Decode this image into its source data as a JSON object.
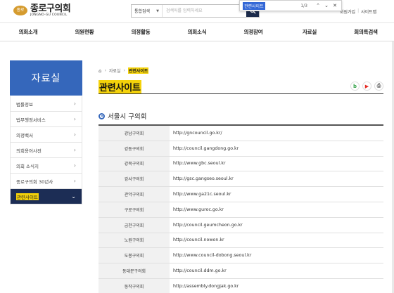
{
  "header": {
    "logo_ko": "종로구의회",
    "logo_en": "JONGNO-GU COUNCIL",
    "logo_mark": "종로",
    "search": {
      "scope": "통합검색",
      "placeholder": "검색어를 입력하세요"
    },
    "util_links": [
      "회원가입",
      "사이트맵"
    ]
  },
  "findbar": {
    "query": "관련사이트",
    "count": "1/3"
  },
  "nav": {
    "items": [
      "의회소개",
      "의원현황",
      "의정활동",
      "의회소식",
      "의정참여",
      "자료실",
      "회의록검색"
    ]
  },
  "sidebar": {
    "title": "자료실",
    "items": [
      {
        "label": "법률정보",
        "active": false
      },
      {
        "label": "법무행정서비스",
        "active": false
      },
      {
        "label": "의정백서",
        "active": false
      },
      {
        "label": "의회용어사전",
        "active": false
      },
      {
        "label": "의회 소식지",
        "active": false
      },
      {
        "label": "종로구의회 30년사",
        "active": false
      },
      {
        "label": "관련사이트",
        "active": true
      }
    ]
  },
  "breadcrumb": {
    "items": [
      "자료실",
      "관련사이트"
    ]
  },
  "page_title": "관련사이트",
  "share": {
    "blog": "b",
    "youtube": "▶",
    "print": "⎙"
  },
  "section_title": "서울시 구의회",
  "table": {
    "rows": [
      {
        "name": "강남구의회",
        "url": "http://gncouncil.go.kr/"
      },
      {
        "name": "강동구의회",
        "url": "http://council.gangdong.go.kr"
      },
      {
        "name": "강북구의회",
        "url": "http://www.gbc.seoul.kr"
      },
      {
        "name": "강서구의회",
        "url": "http://gsc.gangseo.seoul.kr"
      },
      {
        "name": "관악구의회",
        "url": "http://www.ga21c.seoul.kr"
      },
      {
        "name": "구로구의회",
        "url": "http://www.guroc.go.kr"
      },
      {
        "name": "금천구의회",
        "url": "http://council.geumcheon.go.kr"
      },
      {
        "name": "노원구의회",
        "url": "http://council.nowon.kr"
      },
      {
        "name": "도봉구의회",
        "url": "http://www.council-dobong.seoul.kr"
      },
      {
        "name": "동대문구의회",
        "url": "http://council.ddm.go.kr"
      },
      {
        "name": "동작구의회",
        "url": "http://assembly.dongjak.go.kr"
      }
    ]
  },
  "colors": {
    "accent": "#3567bb",
    "nav_dark": "#1c2d55",
    "highlight": "#f4d20a"
  }
}
